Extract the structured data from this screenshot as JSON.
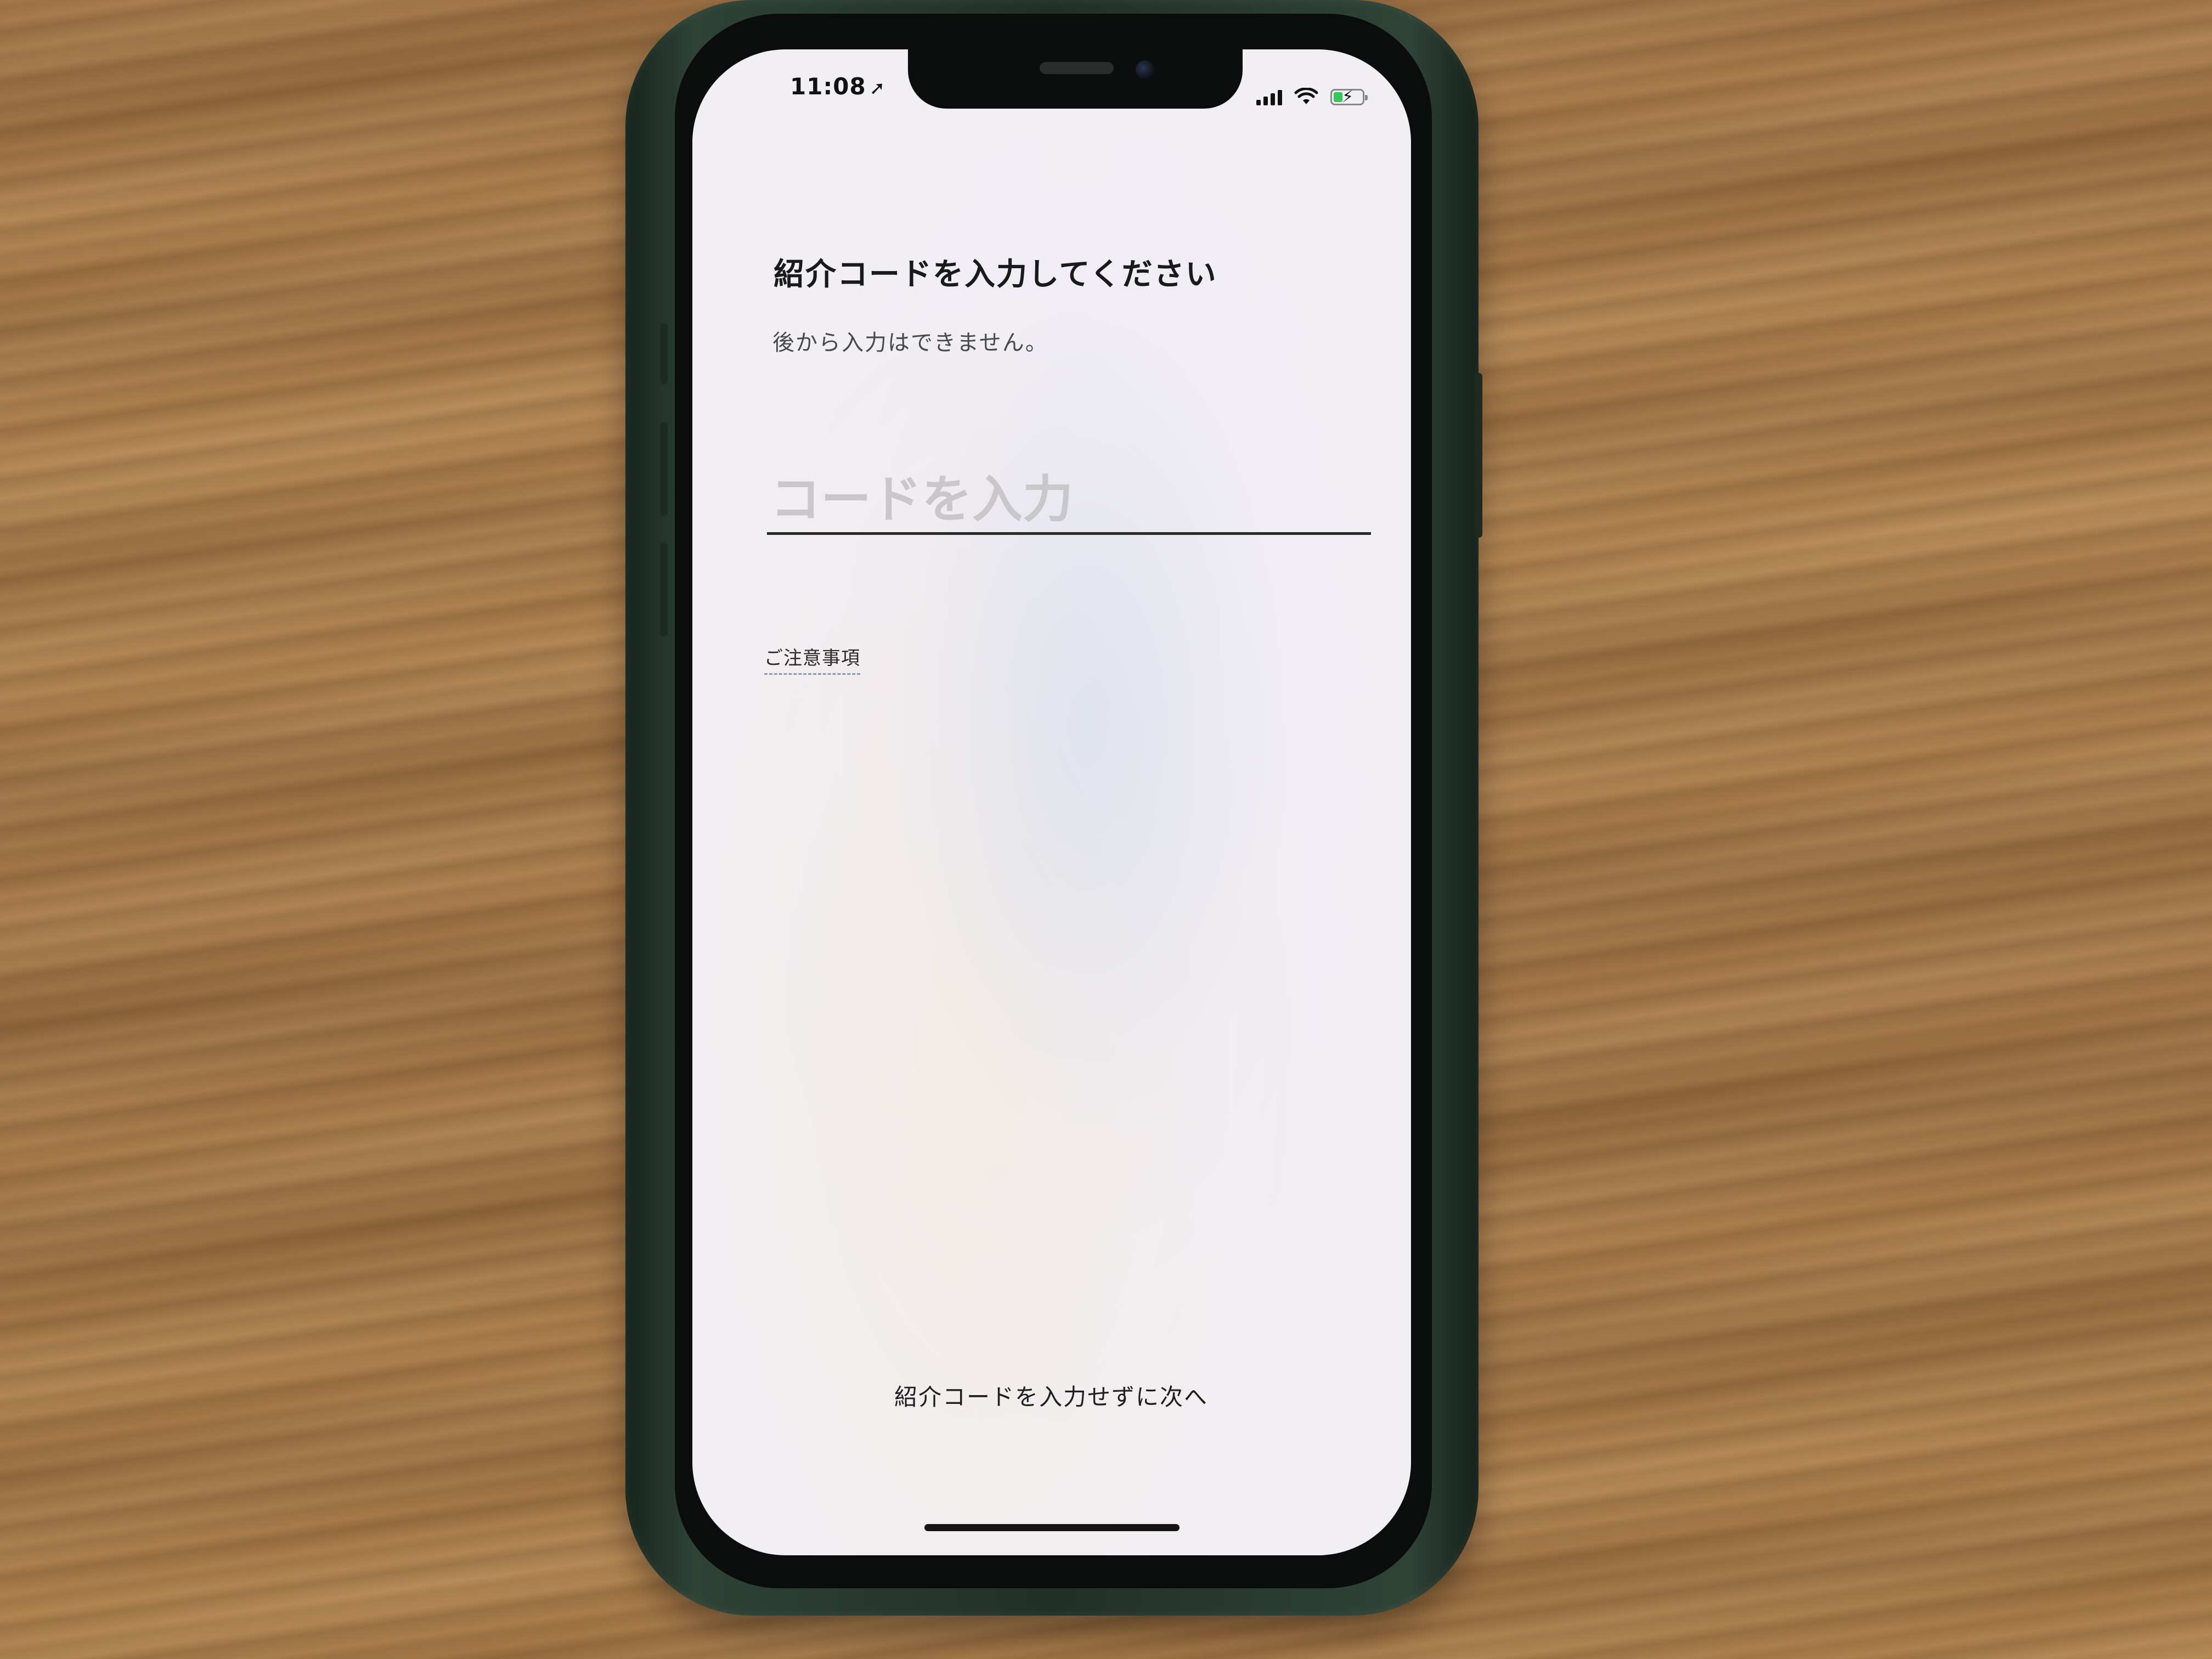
{
  "status_bar": {
    "time": "11:08",
    "location_icon": "location-arrow-icon",
    "signal_icon": "cellular-signal-icon",
    "wifi_icon": "wifi-icon",
    "battery_icon": "battery-charging-icon",
    "battery_color": "#34c759"
  },
  "main": {
    "title": "紹介コードを入力してください",
    "subtitle": "後から入力はできません。",
    "code_input": {
      "value": "",
      "placeholder": "コードを入力"
    },
    "notice_link": "ご注意事項",
    "skip_link": "紹介コードを入力せずに次へ"
  }
}
